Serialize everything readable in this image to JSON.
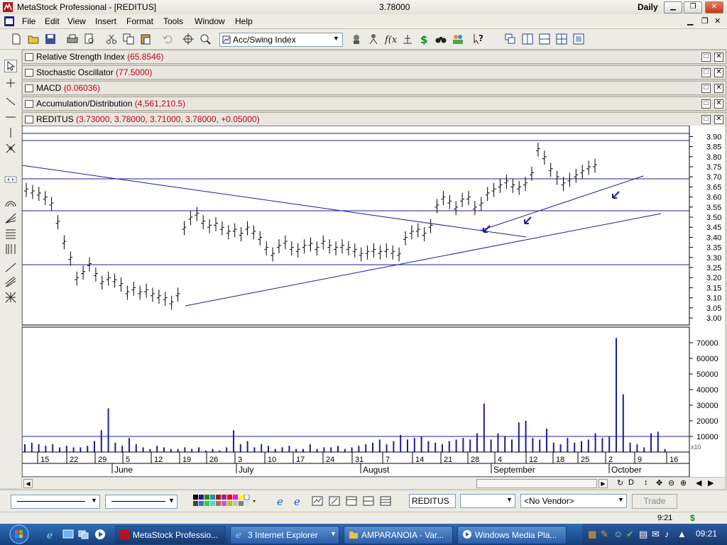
{
  "window": {
    "app_title": "MetaStock Professional - [REDITUS]",
    "last_price": "3.78000",
    "periodicity": "Daily"
  },
  "menu": [
    "File",
    "Edit",
    "View",
    "Insert",
    "Format",
    "Tools",
    "Window",
    "Help"
  ],
  "toolbar": {
    "indicator_select": "Acc/Swing Index"
  },
  "panels": [
    {
      "name": "Relative Strength Index",
      "value": "(65.8546)"
    },
    {
      "name": "Stochastic Oscillator",
      "value": "(77.5000)"
    },
    {
      "name": "MACD",
      "value": "(0.06036)"
    },
    {
      "name": "Accumulation/Distribution",
      "value": "(4,561,210.5)"
    },
    {
      "name": "REDITUS",
      "value": "(3.73000, 3.78000, 3.71000, 3.78000, +0.05000)"
    }
  ],
  "price_axis_ticks": [
    "3.90",
    "3.85",
    "3.80",
    "3.75",
    "3.70",
    "3.65",
    "3.60",
    "3.55",
    "3.50",
    "3.45",
    "3.40",
    "3.35",
    "3.30",
    "3.25",
    "3.20",
    "3.15",
    "3.10",
    "3.05",
    "3.00"
  ],
  "volume_axis_ticks": [
    "70000",
    "60000",
    "50000",
    "40000",
    "30000",
    "20000",
    "10000"
  ],
  "volume_axis_scale": "x10",
  "date_ticks": [
    "15",
    "22",
    "29",
    "5",
    "12",
    "19",
    "26",
    "3",
    "10",
    "17",
    "24",
    "31",
    "7",
    "14",
    "21",
    "28",
    "4",
    "12",
    "18",
    "25",
    "2",
    "9",
    "16"
  ],
  "month_labels": [
    "June",
    "July",
    "August",
    "September",
    "October"
  ],
  "bottom": {
    "symbol": "REDITUS",
    "vendor": "<No Vendor>",
    "trade_label": "Trade"
  },
  "status": {
    "clock": "9:21"
  },
  "taskbar": {
    "tasks": [
      "MetaStock Professio...",
      "3 Internet Explorer",
      "AMPARANOIA - Var...",
      "Windows Media Pla..."
    ],
    "clock": "09:21"
  },
  "colors": {
    "series": "#1c1c9c",
    "value_text": "#c0001a",
    "taskbar": "#1d4e91"
  }
}
